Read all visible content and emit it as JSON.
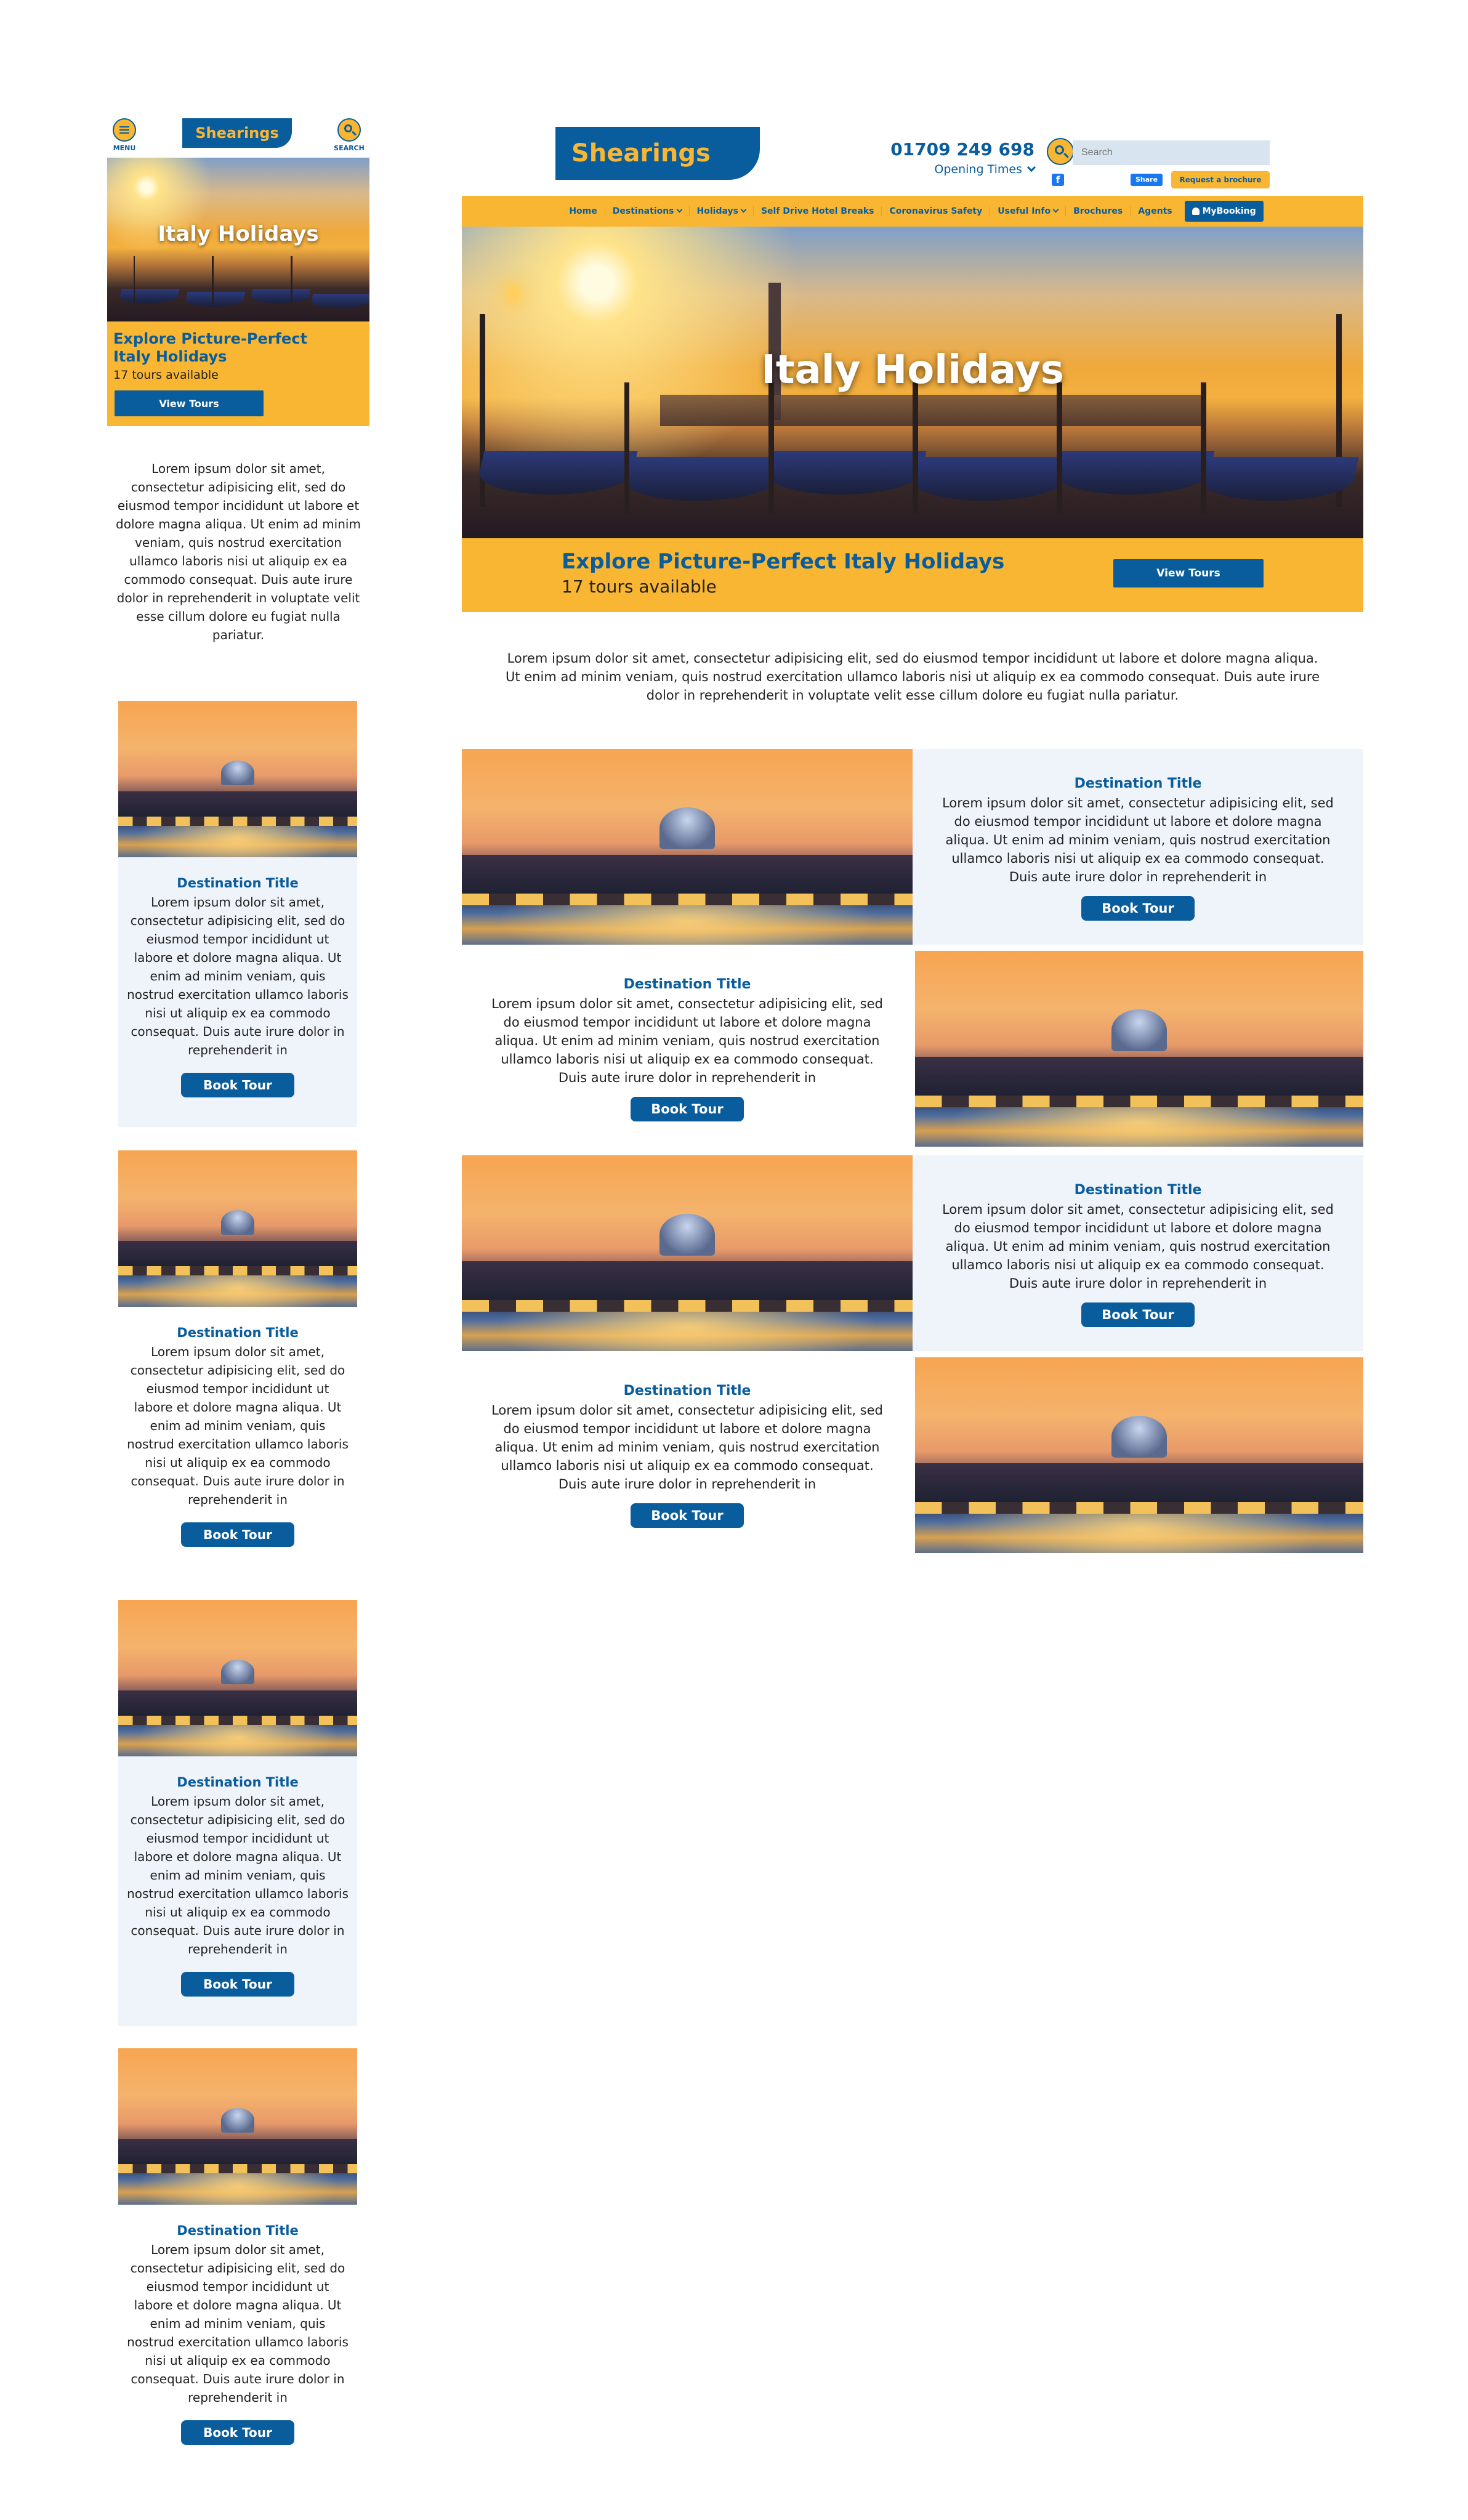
{
  "mobile": {
    "menu_label": "MENU",
    "search_label": "SEARCH",
    "logo": "Shearings",
    "hero_title": "Italy Holidays",
    "banner_title": "Explore Picture-Perfect Italy Holidays",
    "banner_count": "17 tours available",
    "view_tours": "View Tours",
    "intro": "Lorem ipsum dolor sit amet, consectetur adipisicing elit, sed do eiusmod tempor incididunt ut labore et dolore magna aliqua. Ut enim ad minim veniam, quis nostrud exercitation ullamco laboris nisi ut aliquip ex ea commodo consequat. Duis aute irure dolor in reprehenderit in voluptate velit esse cillum dolore eu fugiat nulla pariatur.",
    "cards": [
      {
        "title": "Destination Title",
        "text": "Lorem ipsum dolor sit amet, consectetur adipisicing elit, sed do eiusmod tempor incididunt ut labore et dolore magna aliqua. Ut enim ad minim veniam, quis nostrud exercitation ullamco laboris nisi ut aliquip ex ea commodo consequat. Duis aute irure dolor in reprehenderit in",
        "button": "Book Tour"
      },
      {
        "title": "Destination Title",
        "text": "Lorem ipsum dolor sit amet, consectetur adipisicing elit, sed do eiusmod tempor incididunt ut labore et dolore magna aliqua. Ut enim ad minim veniam, quis nostrud exercitation ullamco laboris nisi ut aliquip ex ea commodo consequat. Duis aute irure dolor in reprehenderit in",
        "button": "Book Tour"
      },
      {
        "title": "Destination Title",
        "text": "Lorem ipsum dolor sit amet, consectetur adipisicing elit, sed do eiusmod tempor incididunt ut labore et dolore magna aliqua. Ut enim ad minim veniam, quis nostrud exercitation ullamco laboris nisi ut aliquip ex ea commodo consequat. Duis aute irure dolor in reprehenderit in",
        "button": "Book Tour"
      },
      {
        "title": "Destination Title",
        "text": "Lorem ipsum dolor sit amet, consectetur adipisicing elit, sed do eiusmod tempor incididunt ut labore et dolore magna aliqua. Ut enim ad minim veniam, quis nostrud exercitation ullamco laboris nisi ut aliquip ex ea commodo consequat. Duis aute irure dolor in reprehenderit in",
        "button": "Book Tour"
      }
    ]
  },
  "desktop": {
    "logo": "Shearings",
    "phone": "01709 249 698",
    "opening_times": "Opening Times",
    "search_placeholder": "Search",
    "share": "Share",
    "request_brochure": "Request a brochure",
    "nav": [
      {
        "label": "Home"
      },
      {
        "label": "Destinations",
        "has_dropdown": true
      },
      {
        "label": "Holidays",
        "has_dropdown": true
      },
      {
        "label": "Self Drive Hotel Breaks"
      },
      {
        "label": "Coronavirus Safety"
      },
      {
        "label": "Useful Info",
        "has_dropdown": true
      },
      {
        "label": "Brochures"
      },
      {
        "label": "Agents"
      }
    ],
    "mybooking": "MyBooking",
    "hero_title": "Italy Holidays",
    "banner_title": "Explore Picture-Perfect Italy Holidays",
    "banner_count": "17 tours available",
    "view_tours": "View Tours",
    "intro": "Lorem ipsum dolor sit amet, consectetur adipisicing elit, sed do eiusmod tempor incididunt ut labore et dolore magna aliqua. Ut enim ad minim veniam, quis nostrud exercitation ullamco laboris nisi ut aliquip ex ea commodo consequat. Duis aute irure dolor in reprehenderit in voluptate velit esse cillum dolore eu fugiat nulla pariatur.",
    "rows": [
      {
        "title": "Destination Title",
        "text": "Lorem ipsum dolor sit amet, consectetur adipisicing elit, sed do eiusmod tempor incididunt ut labore et dolore magna aliqua. Ut enim ad minim veniam, quis nostrud exercitation ullamco laboris nisi ut aliquip ex ea commodo consequat. Duis aute irure dolor in reprehenderit in",
        "button": "Book Tour"
      },
      {
        "title": "Destination Title",
        "text": "Lorem ipsum dolor sit amet, consectetur adipisicing elit, sed do eiusmod tempor incididunt ut labore et dolore magna aliqua. Ut enim ad minim veniam, quis nostrud exercitation ullamco laboris nisi ut aliquip ex ea commodo consequat. Duis aute irure dolor in reprehenderit in",
        "button": "Book Tour"
      },
      {
        "title": "Destination Title",
        "text": "Lorem ipsum dolor sit amet, consectetur adipisicing elit, sed do eiusmod tempor incididunt ut labore et dolore magna aliqua. Ut enim ad minim veniam, quis nostrud exercitation ullamco laboris nisi ut aliquip ex ea commodo consequat. Duis aute irure dolor in reprehenderit in",
        "button": "Book Tour"
      },
      {
        "title": "Destination Title",
        "text": "Lorem ipsum dolor sit amet, consectetur adipisicing elit, sed do eiusmod tempor incididunt ut labore et dolore magna aliqua. Ut enim ad minim veniam, quis nostrud exercitation ullamco laboris nisi ut aliquip ex ea commodo consequat. Duis aute irure dolor in reprehenderit in",
        "button": "Book Tour"
      }
    ]
  },
  "colors": {
    "brand_yellow": "#f9b633",
    "brand_blue": "#0a5d9c",
    "card_bg": "#eff3fa"
  }
}
